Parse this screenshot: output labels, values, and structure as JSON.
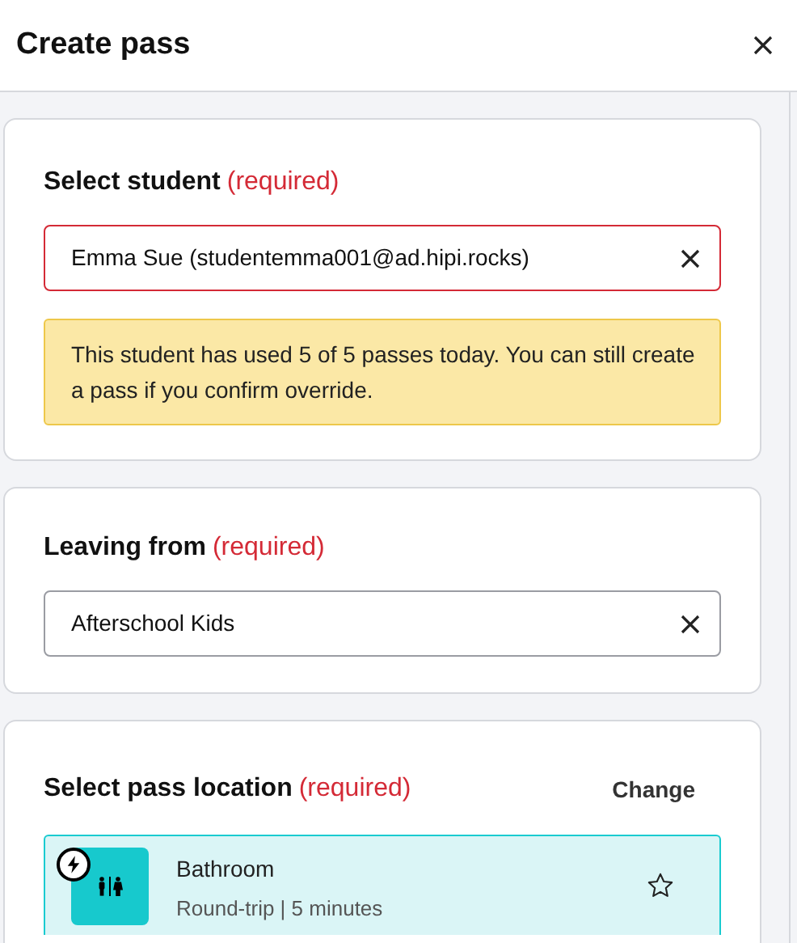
{
  "header": {
    "title": "Create pass"
  },
  "student": {
    "label": "Select student",
    "required": "(required)",
    "value": "Emma Sue (studentemma001@ad.hipi.rocks)",
    "error": true,
    "warning": "This student has used 5 of 5 passes today. You can still create a pass if you confirm override."
  },
  "origin": {
    "label": "Leaving from",
    "required": "(required)",
    "value": "Afterschool Kids",
    "error": false
  },
  "location": {
    "label": "Select pass location",
    "required": "(required)",
    "change": "Change",
    "item": {
      "name": "Bathroom",
      "detail": "Round-trip | 5 minutes",
      "selected": true,
      "favorite": false,
      "quick": true
    }
  }
}
